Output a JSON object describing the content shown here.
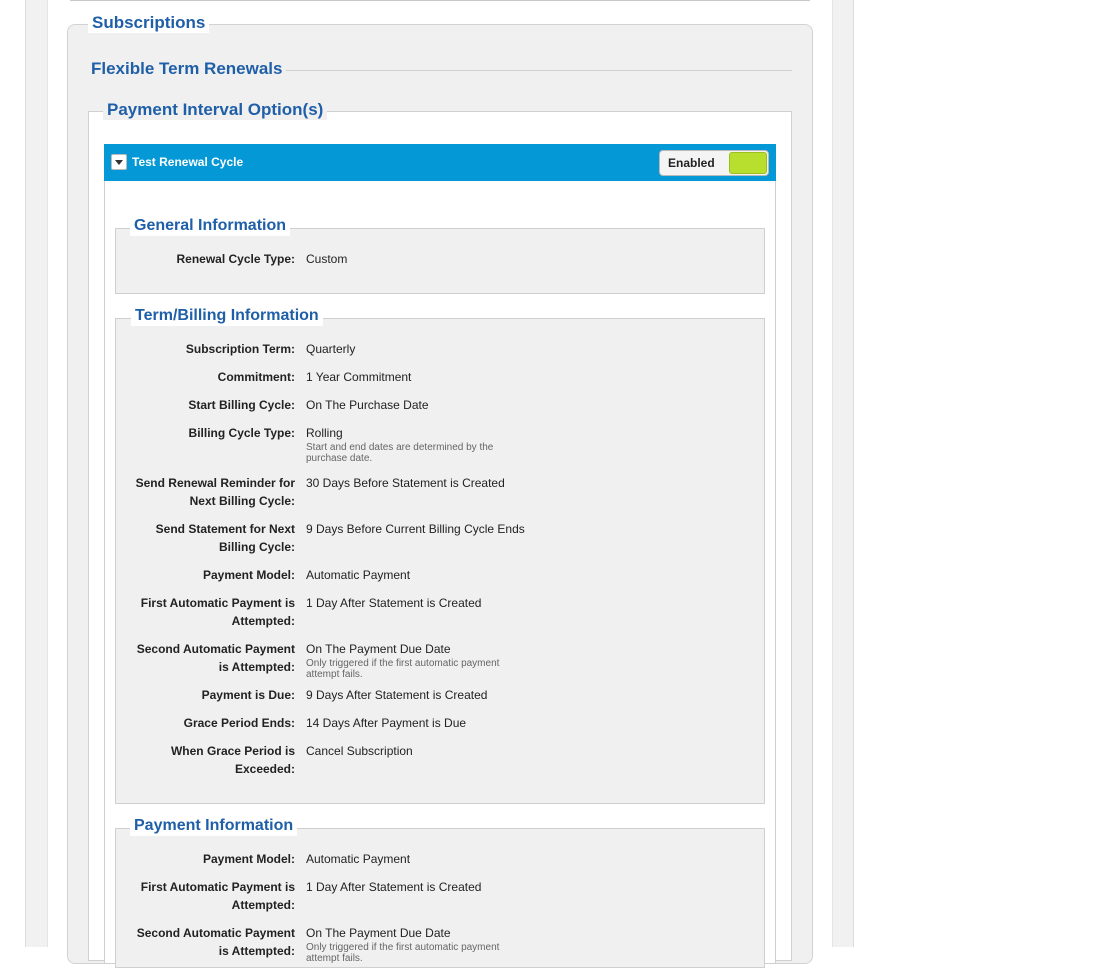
{
  "legends": {
    "subscriptions": "Subscriptions",
    "flexible_term_renewals": "Flexible Term Renewals",
    "payment_interval_options": "Payment Interval Option(s)"
  },
  "cycle": {
    "title": "Test Renewal Cycle",
    "status_label": "Enabled",
    "colors": {
      "header": "#0598d6",
      "toggle_on": "#b9df2e",
      "legend_text": "#1f5fa8"
    }
  },
  "general_information": {
    "title": "General Information",
    "rows": [
      {
        "label": "Renewal Cycle Type:",
        "value": "Custom"
      }
    ]
  },
  "term_billing_information": {
    "title": "Term/Billing Information",
    "rows": [
      {
        "label": "Subscription Term:",
        "value": "Quarterly"
      },
      {
        "label": "Commitment:",
        "value": "1 Year Commitment"
      },
      {
        "label": "Start Billing Cycle:",
        "value": "On The Purchase Date"
      },
      {
        "label": "Billing Cycle Type:",
        "value": "Rolling",
        "note": "Start and end dates are determined by the purchase date."
      },
      {
        "label": "Send Renewal Reminder for Next Billing Cycle:",
        "value": "30 Days Before Statement is Created"
      },
      {
        "label": "Send Statement for Next Billing Cycle:",
        "value": "9 Days Before Current Billing Cycle Ends"
      },
      {
        "label": "Payment Model:",
        "value": "Automatic Payment"
      },
      {
        "label": "First Automatic Payment is Attempted:",
        "value": "1 Day After Statement is Created"
      },
      {
        "label": "Second Automatic Payment is Attempted:",
        "value": "On The Payment Due Date",
        "note": "Only triggered if the first automatic payment attempt fails."
      },
      {
        "label": "Payment is Due:",
        "value": "9 Days After Statement is Created"
      },
      {
        "label": "Grace Period Ends:",
        "value": "14 Days After Payment is Due"
      },
      {
        "label": "When Grace Period is Exceeded:",
        "value": "Cancel Subscription"
      }
    ]
  },
  "payment_information": {
    "title": "Payment Information",
    "rows": [
      {
        "label": "Payment Model:",
        "value": "Automatic Payment"
      },
      {
        "label": "First Automatic Payment is Attempted:",
        "value": "1 Day After Statement is Created"
      },
      {
        "label": "Second Automatic Payment is Attempted:",
        "value": "On The Payment Due Date",
        "note": "Only triggered if the first automatic payment attempt fails."
      }
    ]
  }
}
